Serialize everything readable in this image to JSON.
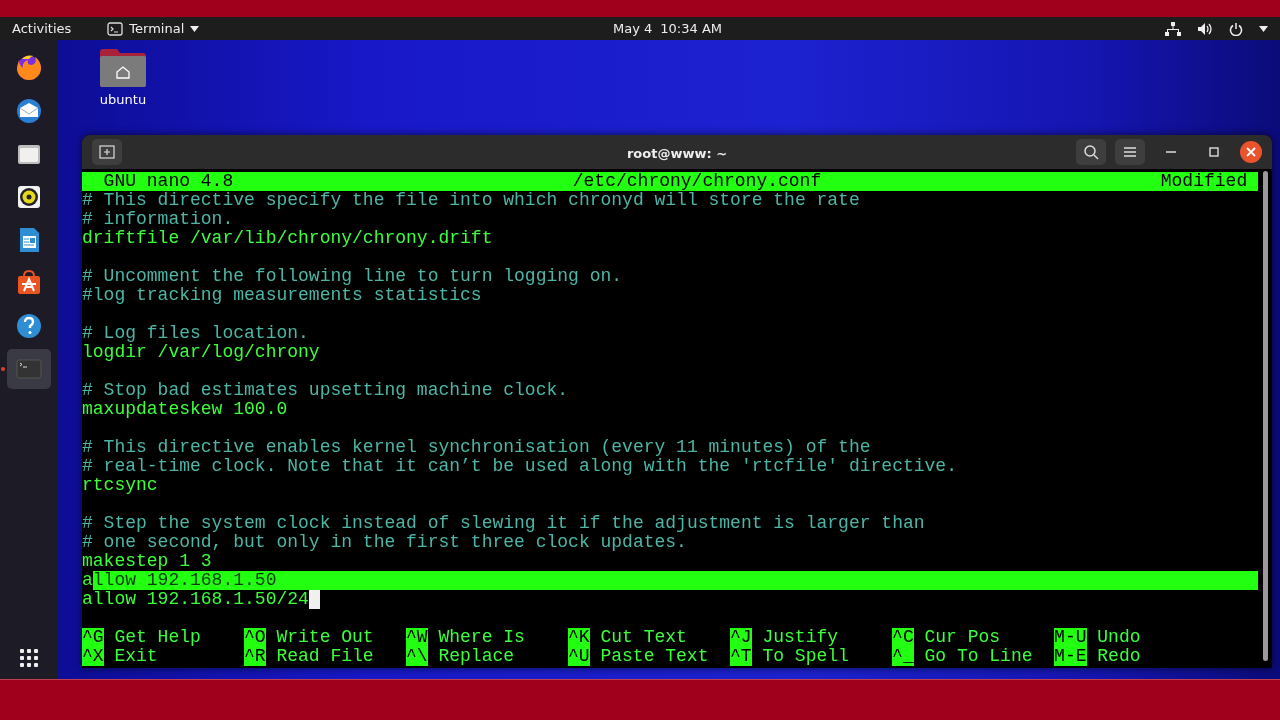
{
  "top_bar": {
    "activities": "Activities",
    "app_menu": "Terminal",
    "date": "May 4",
    "time": "10:34 AM"
  },
  "dock": [
    {
      "kind": "browser",
      "running": false
    },
    {
      "kind": "mail",
      "running": false
    },
    {
      "kind": "files",
      "running": false
    },
    {
      "kind": "music",
      "running": false
    },
    {
      "kind": "document",
      "running": false
    },
    {
      "kind": "store",
      "running": false
    },
    {
      "kind": "help",
      "running": false
    },
    {
      "kind": "terminal",
      "running": true
    }
  ],
  "desktop_icons": [
    {
      "label": "ubuntu"
    }
  ],
  "window": {
    "title": "root@www: ~"
  },
  "nano": {
    "header": {
      "version": "GNU nano 4.8",
      "file": "/etc/chrony/chrony.conf",
      "status": "Modified"
    },
    "lines": [
      {
        "kind": "comment",
        "text": "# This directive specify the file into which chronyd will store the rate"
      },
      {
        "kind": "comment",
        "text": "# information."
      },
      {
        "kind": "directive",
        "text": "driftfile /var/lib/chrony/chrony.drift"
      },
      {
        "kind": "blank"
      },
      {
        "kind": "comment",
        "text": "# Uncomment the following line to turn logging on."
      },
      {
        "kind": "comment",
        "text": "#log tracking measurements statistics"
      },
      {
        "kind": "blank"
      },
      {
        "kind": "comment",
        "text": "# Log files location."
      },
      {
        "kind": "directive",
        "text": "logdir /var/log/chrony"
      },
      {
        "kind": "blank"
      },
      {
        "kind": "comment",
        "text": "# Stop bad estimates upsetting machine clock."
      },
      {
        "kind": "directive",
        "text": "maxupdateskew 100.0"
      },
      {
        "kind": "blank"
      },
      {
        "kind": "comment",
        "text": "# This directive enables kernel synchronisation (every 11 minutes) of the"
      },
      {
        "kind": "comment",
        "text": "# real-time clock. Note that it can’t be used along with the 'rtcfile' directive."
      },
      {
        "kind": "directive",
        "text": "rtcsync"
      },
      {
        "kind": "blank"
      },
      {
        "kind": "comment",
        "text": "# Step the system clock instead of slewing it if the adjustment is larger than"
      },
      {
        "kind": "comment",
        "text": "# one second, but only in the first three clock updates."
      },
      {
        "kind": "directive",
        "text": "makestep 1 3"
      },
      {
        "kind": "directive",
        "text": "allow 192.168.1.50",
        "marked": true
      },
      {
        "kind": "directive",
        "text": "allow 192.168.1.50/24",
        "cursor": true
      }
    ],
    "shortcuts": [
      {
        "key": "^G",
        "label": "Get Help"
      },
      {
        "key": "^O",
        "label": "Write Out"
      },
      {
        "key": "^W",
        "label": "Where Is"
      },
      {
        "key": "^K",
        "label": "Cut Text"
      },
      {
        "key": "^J",
        "label": "Justify"
      },
      {
        "key": "^C",
        "label": "Cur Pos"
      },
      {
        "key": "M-U",
        "label": "Undo"
      },
      {
        "key": "^X",
        "label": "Exit"
      },
      {
        "key": "^R",
        "label": "Read File"
      },
      {
        "key": "^\\",
        "label": "Replace"
      },
      {
        "key": "^U",
        "label": "Paste Text"
      },
      {
        "key": "^T",
        "label": "To Spell"
      },
      {
        "key": "^_",
        "label": "Go To Line"
      },
      {
        "key": "M-E",
        "label": "Redo"
      }
    ]
  }
}
